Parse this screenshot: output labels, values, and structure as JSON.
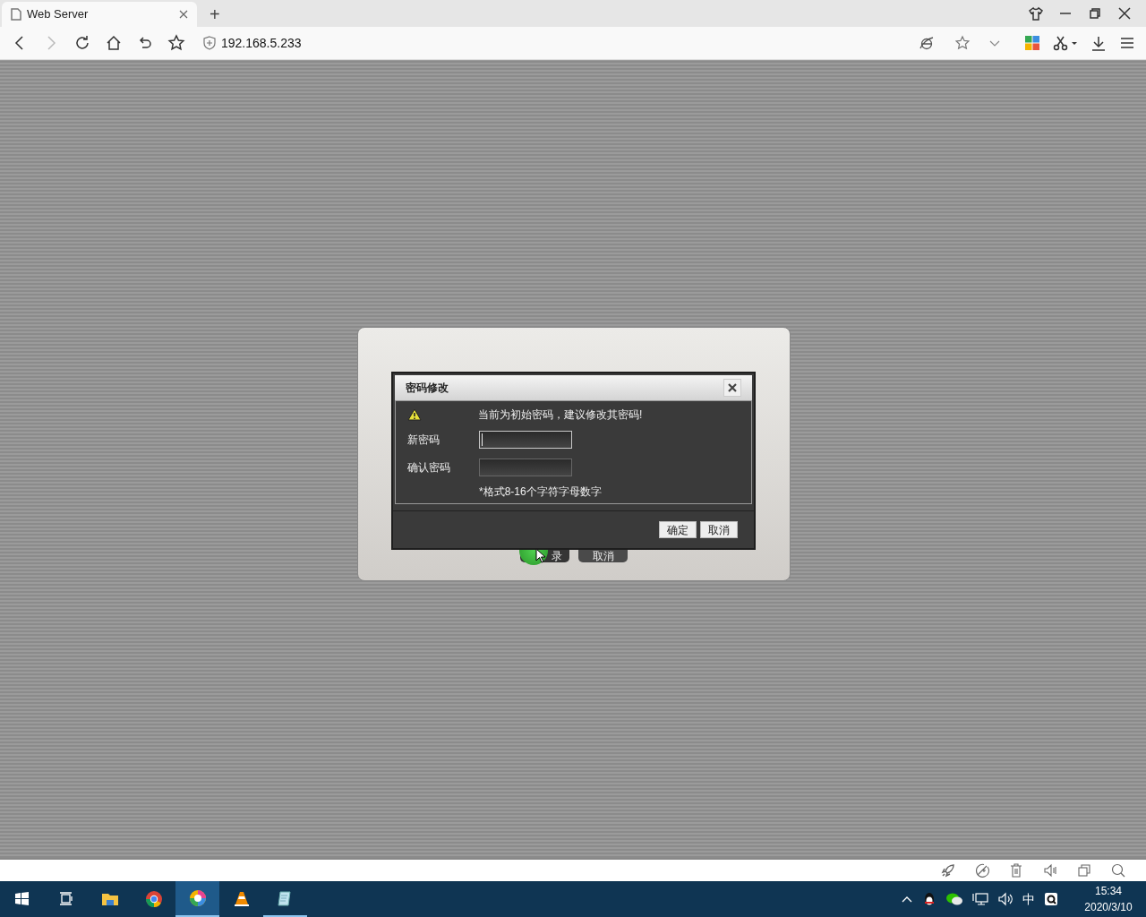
{
  "browser": {
    "tab": {
      "title": "Web Server",
      "selected": true
    },
    "new_tab": "+",
    "address": "192.168.5.233"
  },
  "login_panel": {
    "buttons": [
      {
        "label": "录",
        "hovered": true
      },
      {
        "label": "取消",
        "hovered": false
      }
    ]
  },
  "dialog": {
    "title": "密码修改",
    "warning": "当前为初始密码，建议修改其密码!",
    "fields": [
      {
        "label": "新密码",
        "focused": true
      },
      {
        "label": "确认密码",
        "focused": false
      }
    ],
    "hint": "*格式8-16个字符字母数字",
    "buttons": [
      "确定",
      "取消"
    ]
  },
  "taskbar": {
    "apps": [
      {
        "kind": "start",
        "selected": false,
        "running": false
      },
      {
        "kind": "taskview",
        "selected": false,
        "running": false
      },
      {
        "kind": "folder",
        "selected": false,
        "running": false
      },
      {
        "kind": "chrome",
        "selected": false,
        "running": false
      },
      {
        "kind": "colorwheel",
        "selected": true,
        "running": true
      },
      {
        "kind": "cone",
        "selected": false,
        "running": false
      },
      {
        "kind": "notepad",
        "selected": false,
        "running": true
      }
    ],
    "ime": "中",
    "time": "15:34",
    "date": "2020/3/10"
  }
}
